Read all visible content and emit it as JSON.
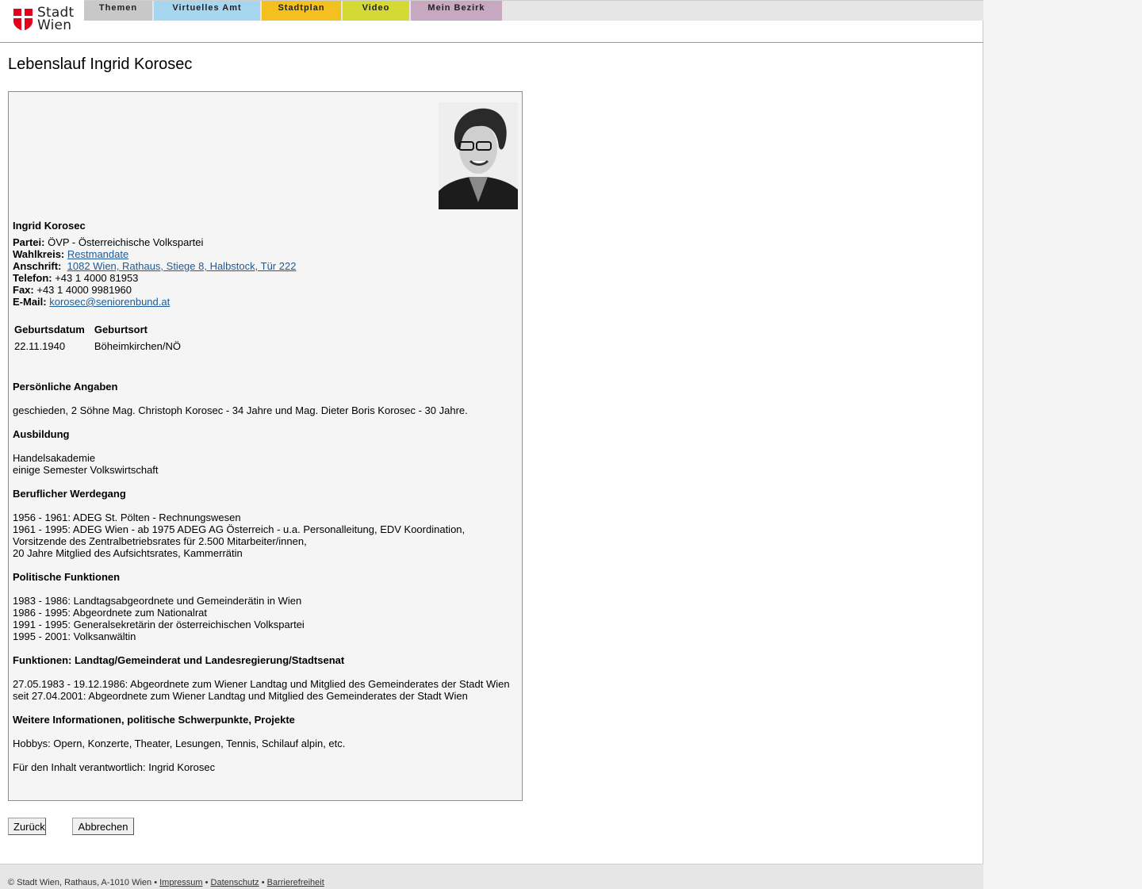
{
  "brand": {
    "logo_text_line1": "Stadt",
    "logo_text_line2": "Wien",
    "shield_color": "#e2001a"
  },
  "nav": {
    "tabs": [
      {
        "label": "Themen",
        "color": "#c8c8c8"
      },
      {
        "label": "Virtuelles Amt",
        "color": "#a6d6f0"
      },
      {
        "label": "Stadtplan",
        "color": "#f4c020"
      },
      {
        "label": "Video",
        "color": "#d4d936"
      },
      {
        "label": "Mein Bezirk",
        "color": "#c8a8c0"
      }
    ]
  },
  "page": {
    "title": "Lebenslauf Ingrid Korosec"
  },
  "profile": {
    "name": "Ingrid Korosec",
    "partei_label": "Partei:",
    "partei": "ÖVP - Österreichische Volkspartei",
    "wahlkreis_label": "Wahlkreis:",
    "wahlkreis": "Restmandate",
    "anschrift_label": "Anschrift:",
    "anschrift": "1082 Wien, Rathaus, Stiege 8, Halbstock, Tür 222",
    "telefon_label": "Telefon:",
    "telefon": "+43 1 4000 81953",
    "fax_label": "Fax:",
    "fax": "+43 1 4000 9981960",
    "email_label": "E-Mail:",
    "email": "korosec@seniorenbund.at"
  },
  "birth": {
    "headers": [
      "Geburtsdatum",
      "Geburtsort"
    ],
    "values": [
      "22.11.1940",
      "Böheimkirchen/NÖ"
    ]
  },
  "sections": [
    {
      "title": "Persönliche Angaben",
      "lines": [
        "geschieden, 2 Söhne Mag. Christoph Korosec - 34 Jahre und Mag. Dieter Boris Korosec - 30 Jahre."
      ]
    },
    {
      "title": "Ausbildung",
      "lines": [
        "Handelsakademie",
        "einige Semester Volkswirtschaft"
      ]
    },
    {
      "title": "Beruflicher Werdegang",
      "lines": [
        "1956 - 1961: ADEG St. Pölten - Rechnungswesen",
        "1961 - 1995: ADEG Wien - ab 1975 ADEG AG Österreich - u.a. Personalleitung, EDV Koordination,",
        "Vorsitzende des Zentralbetriebsrates für 2.500 Mitarbeiter/innen,",
        "20 Jahre Mitglied des Aufsichtsrates, Kammerrätin"
      ]
    },
    {
      "title": "Politische Funktionen",
      "lines": [
        "1983 - 1986: Landtagsabgeordnete und Gemeinderätin in Wien",
        "1986 - 1995: Abgeordnete zum Nationalrat",
        "1991 - 1995: Generalsekretärin der österreichischen Volkspartei",
        "1995 - 2001: Volksanwältin"
      ]
    },
    {
      "title": "Funktionen: Landtag/Gemeinderat und Landesregierung/Stadtsenat",
      "lines": [
        "27.05.1983 - 19.12.1986: Abgeordnete zum Wiener Landtag und Mitglied des Gemeinderates der Stadt Wien",
        "seit 27.04.2001: Abgeordnete zum Wiener Landtag und Mitglied des Gemeinderates der Stadt Wien"
      ]
    },
    {
      "title": "Weitere Informationen, politische Schwerpunkte, Projekte",
      "lines": [
        "Hobbys: Opern, Konzerte, Theater, Lesungen, Tennis, Schilauf alpin, etc."
      ]
    }
  ],
  "responsible": "Für den Inhalt verantwortlich: Ingrid Korosec",
  "buttons": {
    "back": "Zurück",
    "cancel": "Abbrechen"
  },
  "footer": {
    "copyright": "© Stadt Wien, Rathaus, A-1010 Wien",
    "sep": "•",
    "impressum": "Impressum",
    "datenschutz": "Datenschutz",
    "barrierefreiheit": "Barrierefreiheit"
  }
}
